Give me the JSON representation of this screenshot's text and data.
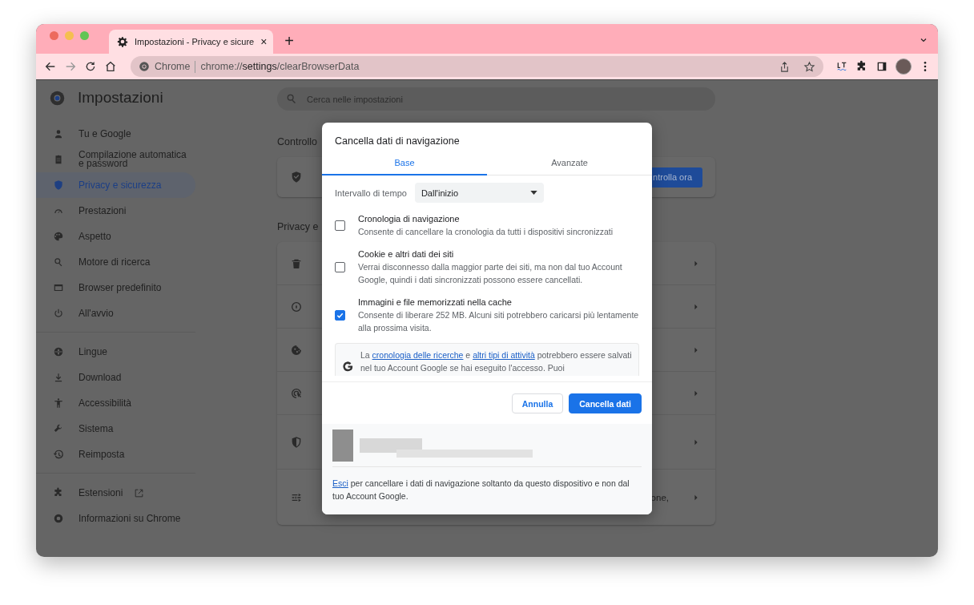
{
  "browser": {
    "tab_title": "Impostazioni - Privacy e sicure",
    "close_glyph": "×",
    "new_tab_glyph": "+",
    "address_label": "Chrome",
    "url": "chrome://**settings**/clearBrowserData"
  },
  "sidebar": {
    "title": "Impostazioni",
    "groups": [
      [
        {
          "label": "Tu e Google",
          "selected": false
        },
        {
          "label": "Compilazione automatica e password",
          "selected": false
        },
        {
          "label": "Privacy e sicurezza",
          "selected": true
        },
        {
          "label": "Prestazioni",
          "selected": false
        },
        {
          "label": "Aspetto",
          "selected": false
        },
        {
          "label": "Motore di ricerca",
          "selected": false
        },
        {
          "label": "Browser predefinito",
          "selected": false
        },
        {
          "label": "All'avvio",
          "selected": false
        }
      ],
      [
        {
          "label": "Lingue",
          "selected": false
        },
        {
          "label": "Download",
          "selected": false
        },
        {
          "label": "Accessibilità",
          "selected": false
        },
        {
          "label": "Sistema",
          "selected": false
        },
        {
          "label": "Reimposta",
          "selected": false
        }
      ],
      [
        {
          "label": "Estensioni",
          "selected": false,
          "external": true
        },
        {
          "label": "Informazioni su Chrome",
          "selected": false,
          "external": false
        }
      ]
    ]
  },
  "main": {
    "search": {
      "placeholder": "Cerca nelle impostazioni"
    },
    "safety_heading": "Controllo",
    "safety_button": "ntrolla ora",
    "privacy_heading": "Privacy e",
    "privacy_rows": [
      {
        "kind": "link"
      },
      {
        "kind": "link"
      },
      {
        "kind": "link"
      },
      {
        "kind": "link"
      },
      {
        "kind": "link"
      },
      {
        "kind": "link",
        "visible_text": "one,"
      }
    ]
  },
  "dialog": {
    "title": "Cancella dati di navigazione",
    "tabs": [
      {
        "label": "Base",
        "selected": true
      },
      {
        "label": "Avanzate",
        "selected": false
      }
    ],
    "time_range": {
      "label": "Intervallo di tempo",
      "value": "Dall'inizio"
    },
    "options": [
      {
        "title": "Cronologia di navigazione",
        "description": "Consente di cancellare la cronologia da tutti i dispositivi sincronizzati",
        "checked": false
      },
      {
        "title": "Cookie e altri dati dei siti",
        "description": "Verrai disconnesso dalla maggior parte dei siti, ma non dal tuo Account Google, quindi i dati sincronizzati possono essere cancellati.",
        "checked": false
      },
      {
        "title": "Immagini e file memorizzati nella cache",
        "description": "Consente di liberare 252 MB. Alcuni siti potrebbero caricarsi più lentamente alla prossima visita.",
        "checked": true
      }
    ],
    "notice": [
      {
        "kind": "plain",
        "text": "La "
      },
      {
        "kind": "link",
        "text": "cronologia delle ricerche"
      },
      {
        "kind": "plain",
        "text": " e "
      },
      {
        "kind": "link",
        "text": "altri tipi di attività"
      },
      {
        "kind": "plain",
        "text": " potrebbero essere salvati nel tuo Account Google se hai eseguito l'accesso. Puoi"
      }
    ],
    "cancel_button": "Annulla",
    "confirm_button": "Cancella dati",
    "footer": {
      "link": "Esci",
      "text": " per cancellare i dati di navigazione soltanto da questo dispositivo e non dal tuo Account Google."
    }
  }
}
